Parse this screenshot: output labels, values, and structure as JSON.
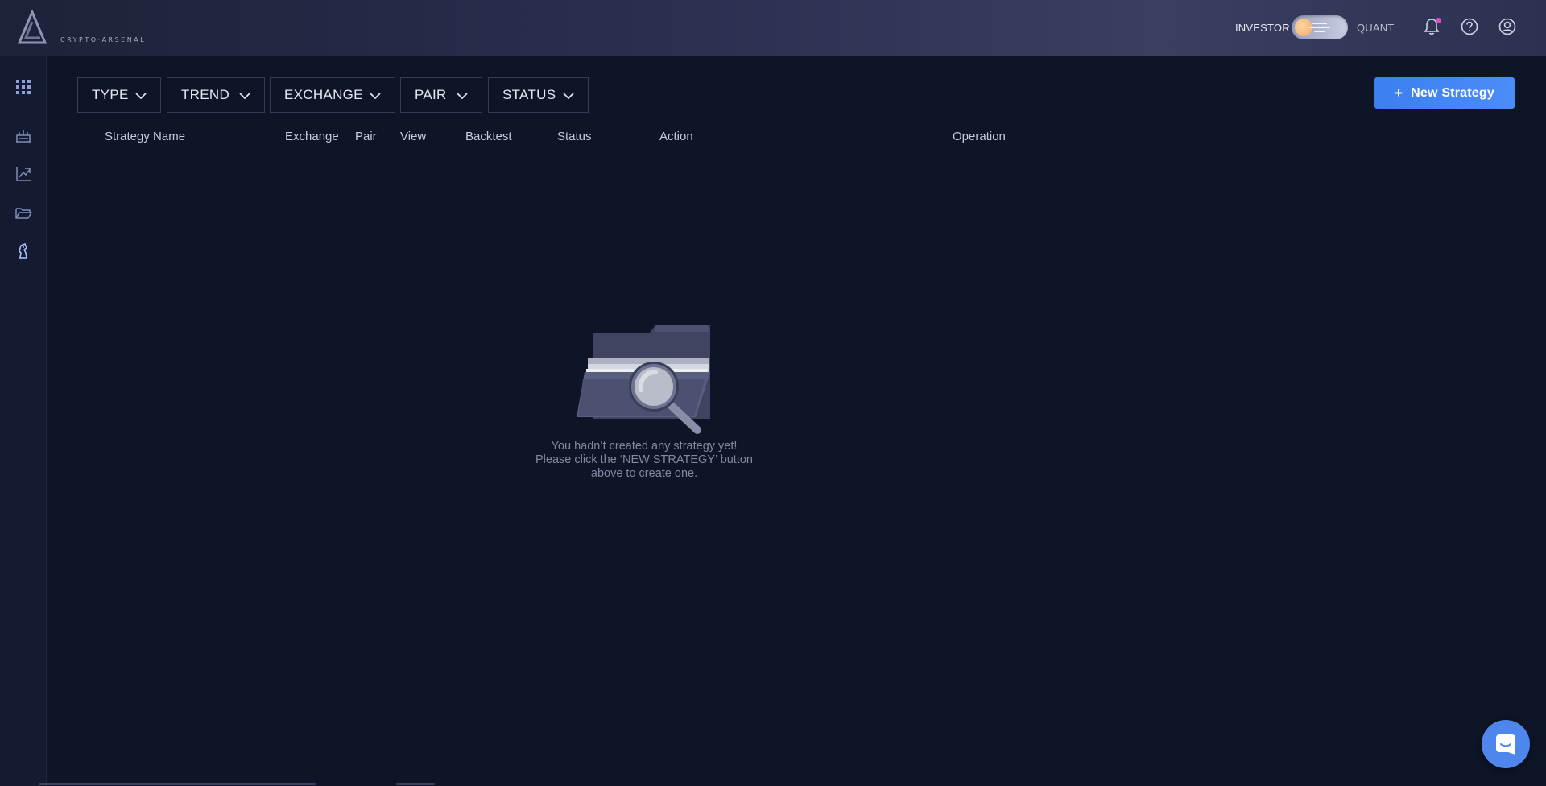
{
  "brand": {
    "logo_text": "CRYPTO·ARSENAL"
  },
  "header": {
    "mode_left": "INVESTOR",
    "mode_right": "QUANT",
    "notification_dot_color": "#d84cc8"
  },
  "sidebar": {
    "items": [
      {
        "icon": "apps-grid-icon"
      },
      {
        "icon": "marketplace-icon"
      },
      {
        "icon": "analytics-icon"
      },
      {
        "icon": "portfolio-folder-icon"
      },
      {
        "icon": "strategy-chess-knight-icon"
      }
    ]
  },
  "filters": {
    "type": "TYPE",
    "trend": "TREND",
    "exchange": "EXCHANGE",
    "pair": "PAIR",
    "status": "STATUS"
  },
  "toolbar": {
    "new_strategy_label": "New Strategy",
    "plus": "+",
    "accent_color": "#4285f4"
  },
  "table": {
    "columns": {
      "strategy_name": "Strategy Name",
      "exchange": "Exchange",
      "pair": "Pair",
      "view": "View",
      "backtest": "Backtest",
      "status": "Status",
      "action": "Action",
      "operation": "Operation"
    }
  },
  "empty_state": {
    "line1": "You hadn’t created any strategy yet!",
    "line2": "Please click the ‘NEW STRATEGY’ button",
    "line3": "above to create one."
  }
}
